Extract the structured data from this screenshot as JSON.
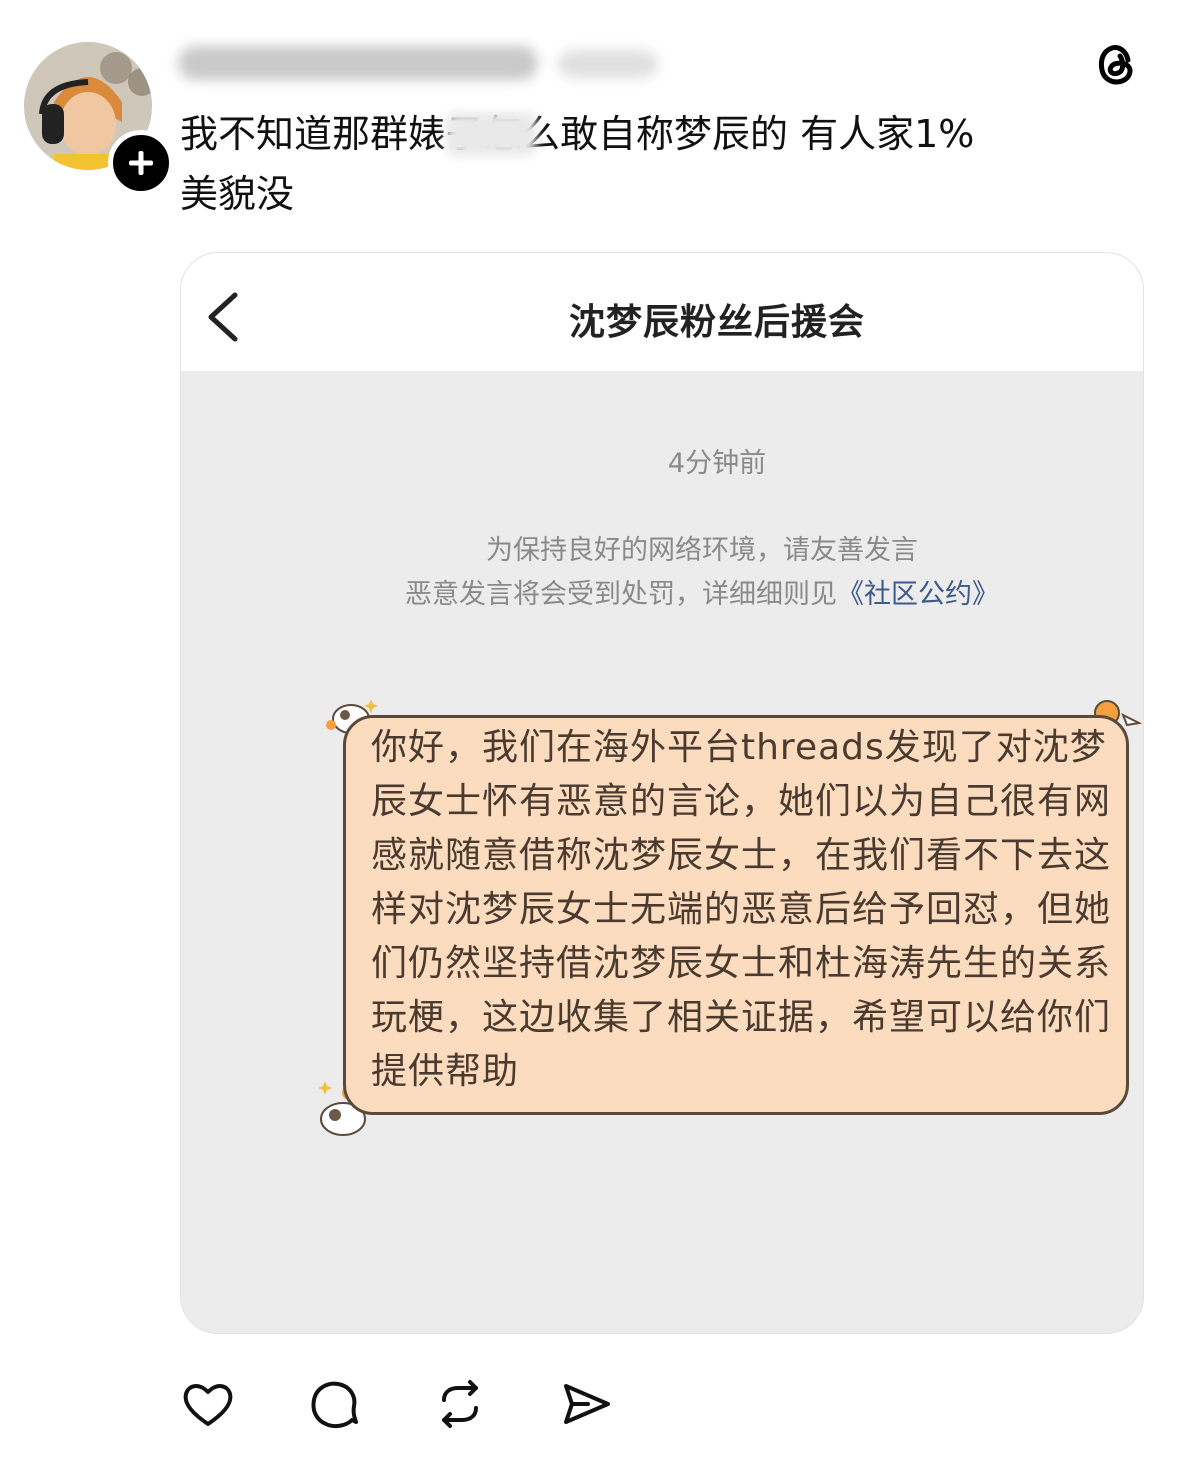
{
  "post": {
    "username": "",
    "text": "我不知道那群婊子怎么敢自称梦辰的 有人家1%\n美貌没",
    "avatar_icon": "avatar-photo",
    "follow_icon": "plus-icon",
    "app_logo_icon": "threads-logo-icon"
  },
  "screenshot": {
    "title": "沈梦辰粉丝后援会",
    "timestamp": "4分钟前",
    "notice_line1": "为保持良好的网络环境，请友善发言",
    "notice_line2": "恶意发言将会受到处罚，详细细则见",
    "notice_link": "《社区公约》",
    "message": "你好，我们在海外平台threads发现了对沈梦辰女士怀有恶意的言论，她们以为自己很有网感就随意借称沈梦辰女士，在我们看不下去这样对沈梦辰女士无端的恶意后给予回怼，但她们仍然坚持借沈梦辰女士和杜海涛先生的关系玩梗，这边收集了相关证据，希望可以给你们提供帮助",
    "bubble_color": "#fbdcbf",
    "header_back_icon": "chevron-left-icon"
  },
  "actions": {
    "like_icon": "heart-icon",
    "comment_icon": "comment-bubble-icon",
    "repost_icon": "repost-icon",
    "share_icon": "send-icon"
  }
}
